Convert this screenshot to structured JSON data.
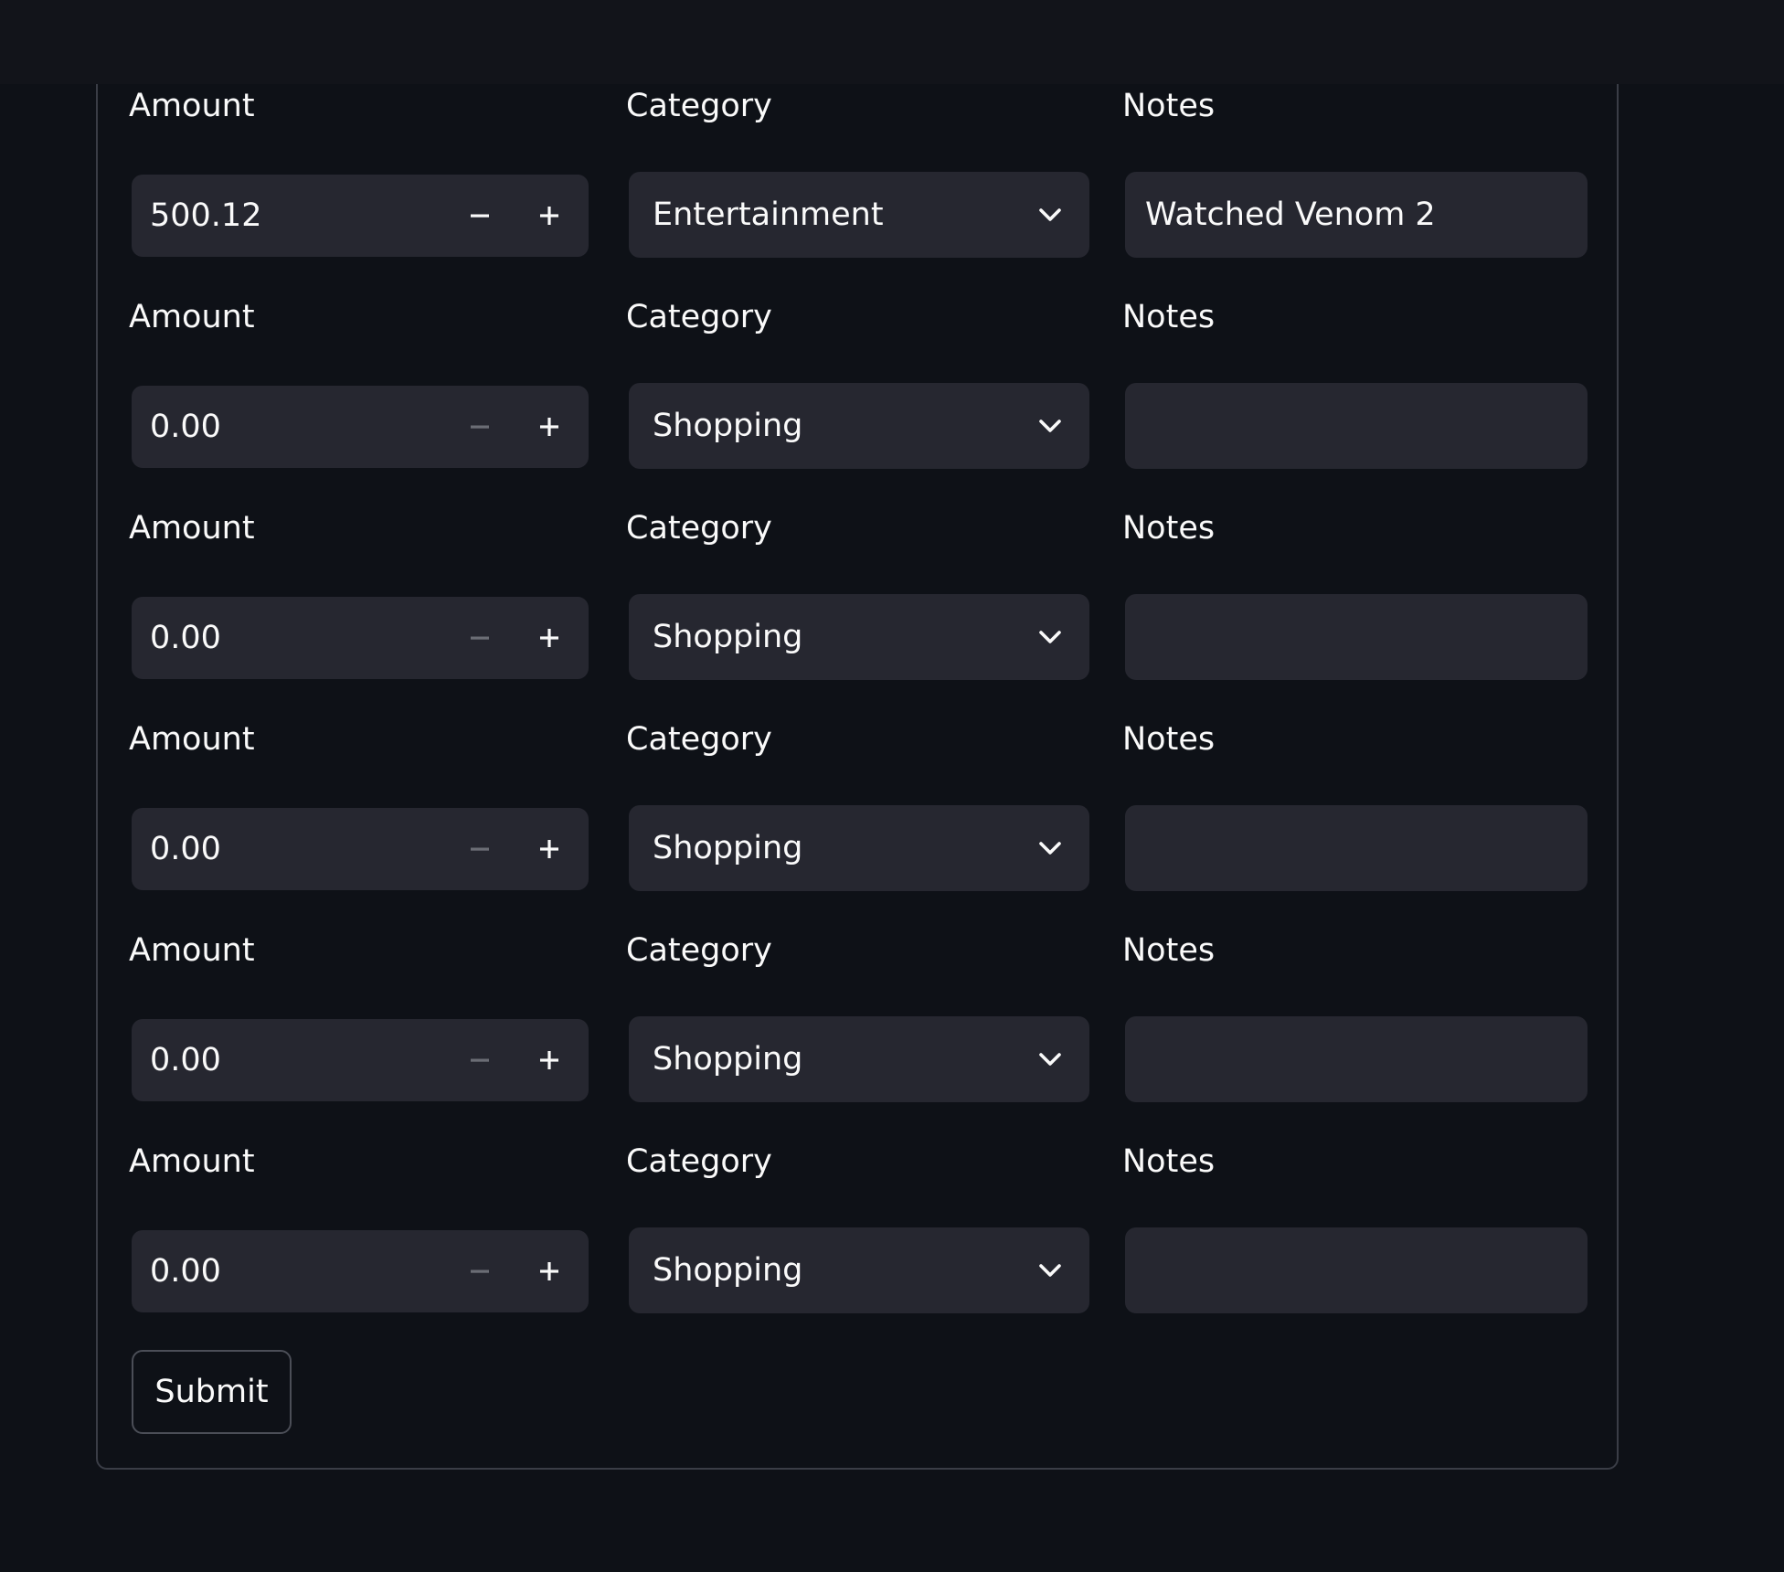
{
  "rows": [
    {
      "amount_label": "Amount",
      "amount": "500.12",
      "category_label": "Category",
      "category": "Entertainment",
      "notes_label": "Notes",
      "notes": "Watched Venom 2",
      "minus_enabled": true
    },
    {
      "amount_label": "Amount",
      "amount": "0.00",
      "category_label": "Category",
      "category": "Shopping",
      "notes_label": "Notes",
      "notes": "",
      "minus_enabled": false
    },
    {
      "amount_label": "Amount",
      "amount": "0.00",
      "category_label": "Category",
      "category": "Shopping",
      "notes_label": "Notes",
      "notes": "",
      "minus_enabled": false
    },
    {
      "amount_label": "Amount",
      "amount": "0.00",
      "category_label": "Category",
      "category": "Shopping",
      "notes_label": "Notes",
      "notes": "",
      "minus_enabled": false
    },
    {
      "amount_label": "Amount",
      "amount": "0.00",
      "category_label": "Category",
      "category": "Shopping",
      "notes_label": "Notes",
      "notes": "",
      "minus_enabled": false
    },
    {
      "amount_label": "Amount",
      "amount": "0.00",
      "category_label": "Category",
      "category": "Shopping",
      "notes_label": "Notes",
      "notes": "",
      "minus_enabled": false
    }
  ],
  "submit_label": "Submit",
  "colors": {
    "background": "#0e1117",
    "control": "#262730",
    "text": "#fafafa",
    "disabled_icon": "#6b6d75",
    "border": "#3a3d46"
  },
  "icons": {
    "decrement": "minus-icon",
    "increment": "plus-icon",
    "dropdown": "chevron-down-icon"
  }
}
